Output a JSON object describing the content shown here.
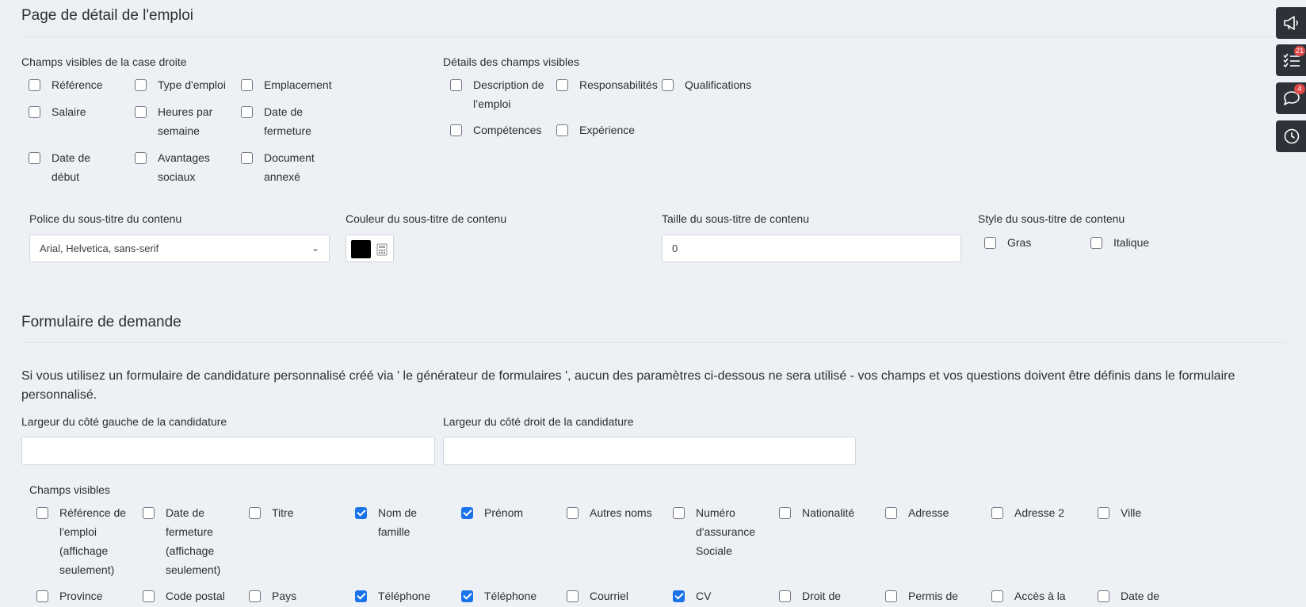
{
  "job_detail": {
    "title": "Page de détail de l'emploi",
    "right_box_label": "Champs visibles de la case droite",
    "right_box_fields": [
      {
        "label": "Référence",
        "checked": false
      },
      {
        "label": "Type d'emploi",
        "checked": false
      },
      {
        "label": "Emplacement",
        "checked": false
      },
      {
        "label": "Salaire",
        "checked": false
      },
      {
        "label": "Heures par semaine",
        "checked": false
      },
      {
        "label": "Date de fermeture",
        "checked": false
      },
      {
        "label": "Date de début",
        "checked": false
      },
      {
        "label": "Avantages sociaux",
        "checked": false
      },
      {
        "label": "Document annexé",
        "checked": false
      }
    ],
    "details_label": "Détails des champs visibles",
    "details_fields": [
      {
        "label": "Description de l’emploi",
        "checked": false
      },
      {
        "label": "Responsabilités",
        "checked": false
      },
      {
        "label": "Qualifications",
        "checked": false
      },
      {
        "label": "Compétences",
        "checked": false
      },
      {
        "label": "Expérience",
        "checked": false
      }
    ],
    "font_label": "Police du sous-titre du contenu",
    "font_value": "Arial, Helvetica, sans-serif",
    "color_label": "Couleur du sous-titre de contenu",
    "color_value": "#000000",
    "size_label": "Taille du sous-titre de contenu",
    "size_value": "0",
    "style_label": "Style du sous-titre de contenu",
    "style_options": [
      {
        "label": "Gras",
        "checked": false
      },
      {
        "label": "Italique",
        "checked": false
      }
    ]
  },
  "application_form": {
    "title": "Formulaire de demande",
    "notice": "Si vous utilisez un formulaire de candidature personnalisé créé via ' le générateur de formulaires ', aucun des paramètres ci-dessous ne sera utilisé - vos champs et vos questions doivent être définis dans le formulaire personnalisé.",
    "left_width_label": "Largeur du côté gauche de la candidature",
    "left_width_value": "",
    "right_width_label": "Largeur du côté droit de la candidature",
    "right_width_value": "",
    "visible_label": "Champs visibles",
    "visible_fields_row1": [
      {
        "label": "Référence de l'emploi (affichage seulement)",
        "checked": false
      },
      {
        "label": "Date de fermeture (affichage seulement)",
        "checked": false
      },
      {
        "label": "Titre",
        "checked": false
      },
      {
        "label": "Nom de famille",
        "checked": true
      },
      {
        "label": "Prénom",
        "checked": true
      },
      {
        "label": "Autres noms",
        "checked": false
      },
      {
        "label": "Numéro d'assurance Sociale",
        "checked": false
      },
      {
        "label": "Nationalité",
        "checked": false
      },
      {
        "label": "Adresse",
        "checked": false
      },
      {
        "label": "Adresse 2",
        "checked": false
      },
      {
        "label": "Ville",
        "checked": false
      }
    ],
    "visible_fields_row2": [
      {
        "label": "Province",
        "checked": false
      },
      {
        "label": "Code postal",
        "checked": false
      },
      {
        "label": "Pays",
        "checked": false
      },
      {
        "label": "Téléphone",
        "checked": true
      },
      {
        "label": "Téléphone",
        "checked": true
      },
      {
        "label": "Courriel",
        "checked": false
      },
      {
        "label": "CV",
        "checked": true
      },
      {
        "label": "Droit de",
        "checked": false
      },
      {
        "label": "Permis de",
        "checked": false
      },
      {
        "label": "Accès à la",
        "checked": false
      },
      {
        "label": "Date de",
        "checked": false
      }
    ]
  },
  "side_toolbar": {
    "buttons": [
      {
        "icon": "megaphone-icon",
        "badge": ""
      },
      {
        "icon": "checklist-icon",
        "badge": "21"
      },
      {
        "icon": "chat-icon",
        "badge": "4"
      },
      {
        "icon": "clock-icon",
        "badge": ""
      }
    ]
  }
}
